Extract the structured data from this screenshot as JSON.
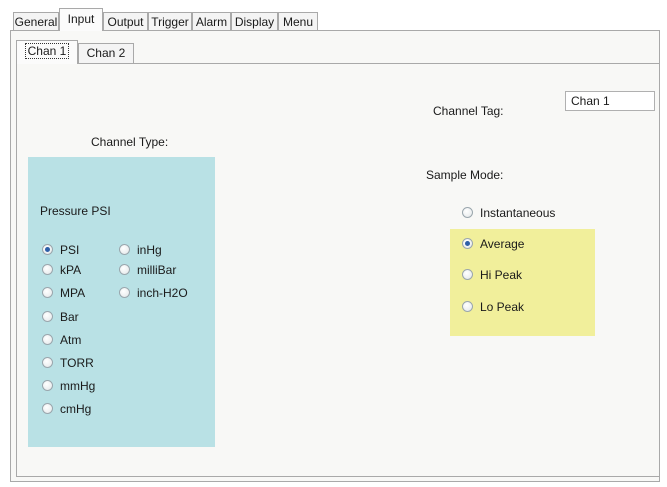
{
  "tabs": [
    "General",
    "Input",
    "Output",
    "Trigger",
    "Alarm",
    "Display",
    "Menu"
  ],
  "active_tab": "Input",
  "subtabs": [
    "Chan 1",
    "Chan 2"
  ],
  "active_subtab": "Chan 1",
  "channel_tag": {
    "label": "Channel Tag:",
    "value": "Chan 1"
  },
  "channel_type": {
    "label": "Channel Type:",
    "group_label": "Pressure PSI",
    "options": [
      "PSI",
      "kPA",
      "MPA",
      "Bar",
      "Atm",
      "TORR",
      "mmHg",
      "cmHg",
      "inHg",
      "milliBar",
      "inch-H2O"
    ],
    "selected": "PSI"
  },
  "sample_mode": {
    "label": "Sample Mode:",
    "options": [
      "Instantaneous",
      "Average",
      "Hi Peak",
      "Lo Peak"
    ],
    "selected": "Average"
  },
  "colors": {
    "channel_type_bg": "#b9e1e5",
    "sample_mode_highlight": "#f1ef9b"
  }
}
